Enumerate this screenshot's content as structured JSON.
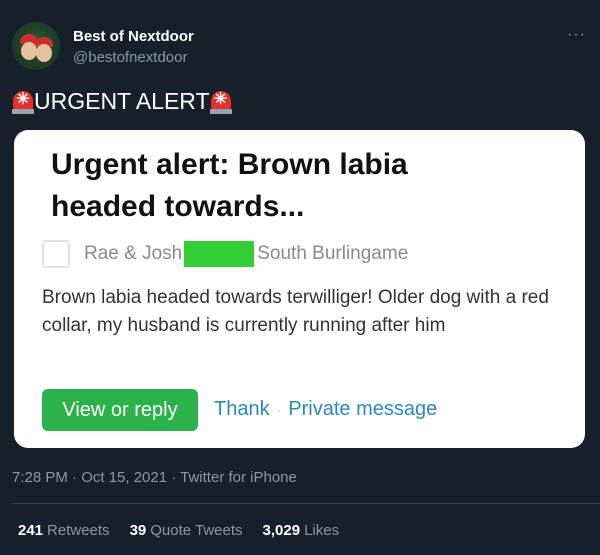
{
  "account": {
    "name": "Best of Nextdoor",
    "handle": "@bestofnextdoor"
  },
  "more_glyph": "···",
  "tweet": {
    "text": "URGENT ALERT",
    "icon": "rotating-light-icon"
  },
  "card": {
    "title": "Urgent alert: Brown labia headed towards...",
    "author": "Rae & Josh",
    "location": "South Burlingame",
    "body": "Brown labia headed towards terwilliger! Older dog with a red collar, my husband is currently running after him",
    "view_button": "View or reply",
    "thank_link": "Thank",
    "separator": "·",
    "private_link": "Private message",
    "redaction_color": "#35cf35"
  },
  "meta": {
    "timestamp": "7:28 PM · Oct 15, 2021 · Twitter for iPhone"
  },
  "stats": {
    "retweets": {
      "count": "241",
      "label": "Retweets"
    },
    "quotes": {
      "count": "39",
      "label": "Quote Tweets"
    },
    "likes": {
      "count": "3,029",
      "label": "Likes"
    }
  },
  "colors": {
    "background": "#15202b",
    "secondary_text": "#8b98a5",
    "accent_green": "#2bb34a",
    "link_blue": "#2b8ac4"
  }
}
